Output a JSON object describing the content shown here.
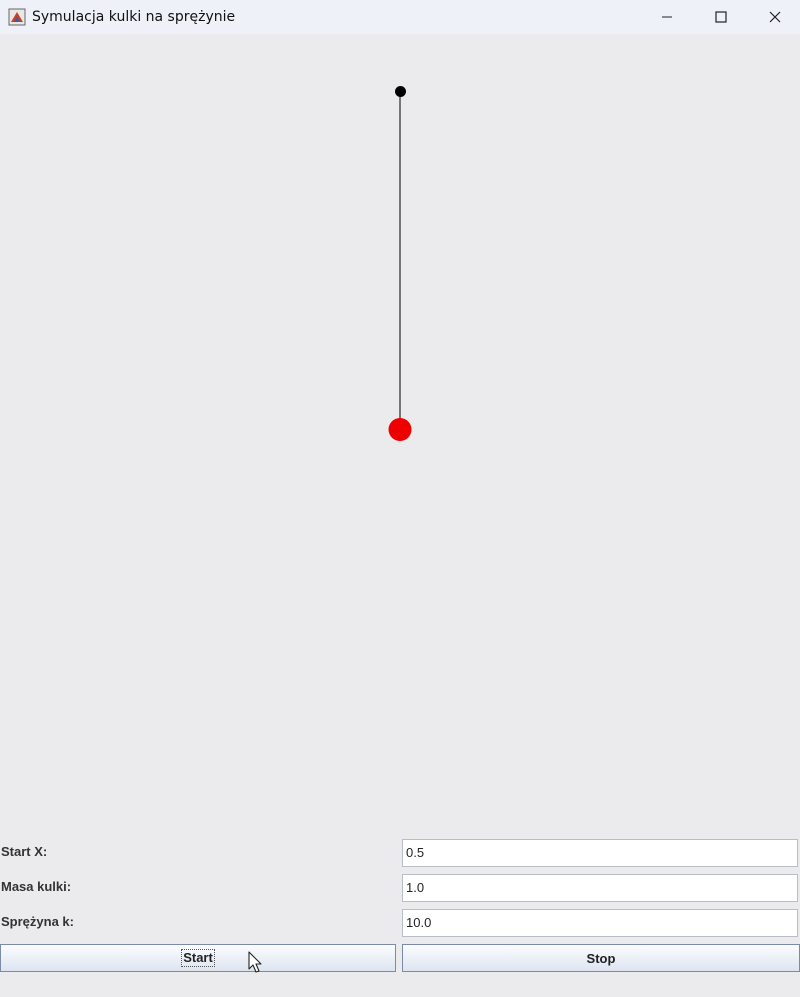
{
  "window": {
    "title": "Symulacja kulki na sprężynie",
    "controls": [
      "minimize-icon",
      "maximize-icon",
      "close-icon"
    ]
  },
  "simulation": {
    "spring_color": "#000000",
    "anchor_color": "#000000",
    "ball_color": "#ee0000"
  },
  "form": {
    "start_x": {
      "label": "Start X:",
      "value": "0.5"
    },
    "mass": {
      "label": "Masa kulki:",
      "value": "1.0"
    },
    "spring_k": {
      "label": "Sprężyna k:",
      "value": "10.0"
    }
  },
  "buttons": {
    "start": "Start",
    "stop": "Stop"
  },
  "colors": {
    "background": "#ebebed",
    "titlebar": "#eef1f8"
  }
}
